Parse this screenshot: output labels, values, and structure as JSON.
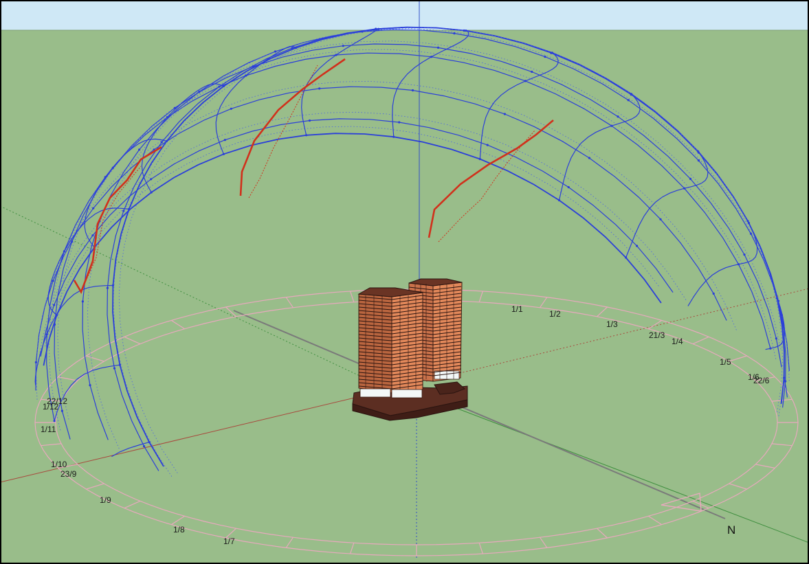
{
  "scene": {
    "colors": {
      "sky": "#cfe8f6",
      "ground": "#99bd8a",
      "sun_path": "#2b3fd9",
      "sun_path_dotted": "#4a62e8",
      "highlight_path": "#d1301b",
      "ground_ring": "#e8a9be",
      "building_facade": "#e2885a",
      "building_podium": "#5c2e22",
      "axis_red": "#a8483c",
      "axis_green": "#3f8f3f",
      "axis_blue": "#3350c8"
    },
    "north_label": "N",
    "date_labels": [
      {
        "id": "1-1",
        "text": "1/1"
      },
      {
        "id": "1-2",
        "text": "1/2"
      },
      {
        "id": "1-3",
        "text": "1/3"
      },
      {
        "id": "21-3",
        "text": "21/3"
      },
      {
        "id": "1-4",
        "text": "1/4"
      },
      {
        "id": "1-5",
        "text": "1/5"
      },
      {
        "id": "1-6",
        "text": "1/6"
      },
      {
        "id": "22-6",
        "text": "22/6"
      },
      {
        "id": "1-7",
        "text": "1/7"
      },
      {
        "id": "1-8",
        "text": "1/8"
      },
      {
        "id": "1-9",
        "text": "1/9"
      },
      {
        "id": "23-9",
        "text": "23/9"
      },
      {
        "id": "1-10",
        "text": "1/10"
      },
      {
        "id": "1-11",
        "text": "1/11"
      },
      {
        "id": "1-12",
        "text": "1/12"
      },
      {
        "id": "22-12",
        "text": "22/12"
      }
    ]
  }
}
